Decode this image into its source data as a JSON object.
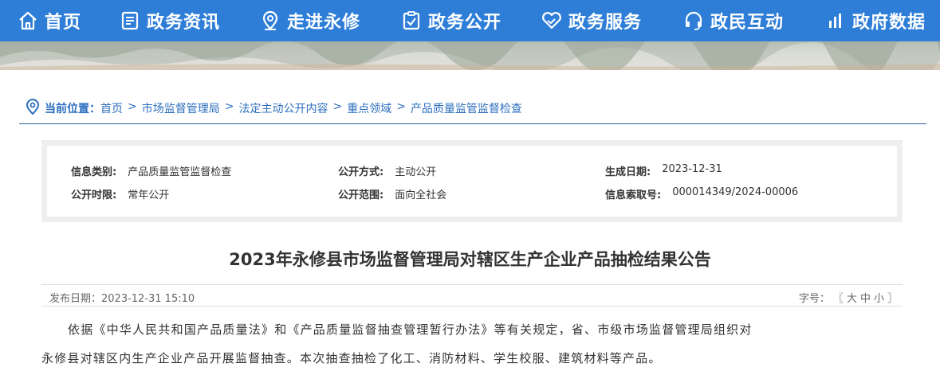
{
  "nav": {
    "items": [
      {
        "label": "首页",
        "icon": "home-icon"
      },
      {
        "label": "政务资讯",
        "icon": "news-icon"
      },
      {
        "label": "走进永修",
        "icon": "location-icon"
      },
      {
        "label": "政务公开",
        "icon": "clipboard-check-icon"
      },
      {
        "label": "政务服务",
        "icon": "handshake-heart-icon"
      },
      {
        "label": "政民互动",
        "icon": "headset-icon"
      },
      {
        "label": "政府数据",
        "icon": "bar-chart-icon"
      }
    ]
  },
  "breadcrumb": {
    "label": "当前位置：",
    "items": [
      "首页",
      "市场监督管理局",
      "法定主动公开内容",
      "重点领域",
      "产品质量监管监督检查"
    ],
    "separator": ">"
  },
  "info": {
    "category_key": "信息类别:",
    "category_value": "产品质量监管监督检查",
    "method_key": "公开方式:",
    "method_value": "主动公开",
    "created_key": "生成日期:",
    "created_value": "2023-12-31",
    "time_key": "公开时限:",
    "time_value": "常年公开",
    "scope_key": "公开范围:",
    "scope_value": "面向全社会",
    "index_key": "信息索取号:",
    "index_value": "000014349/2024-00006"
  },
  "article": {
    "title": "2023年永修县市场监督管理局对辖区生产企业产品抽检结果公告",
    "publish_date": "发布日期：2023-12-31 15:10",
    "font_size_label": "字号：",
    "font_bracket_open": "〖",
    "font_large": "大",
    "font_medium": "中",
    "font_small": "小",
    "font_bracket_close": "〗",
    "para1_line1": "依据《中华人民共和国产品质量法》和《产品质量监督抽查管理暂行办法》等有关规定，省、市级市场监督管理局组织对",
    "para1_line2": "永修县对辖区内生产企业产品开展监督抽查。本次抽查抽检了化工、消防材料、学生校服、建筑材料等产品。"
  },
  "colors": {
    "nav_bg": "#2e7ed8",
    "link": "#2c6fbf",
    "rule": "#2f5fa8"
  }
}
